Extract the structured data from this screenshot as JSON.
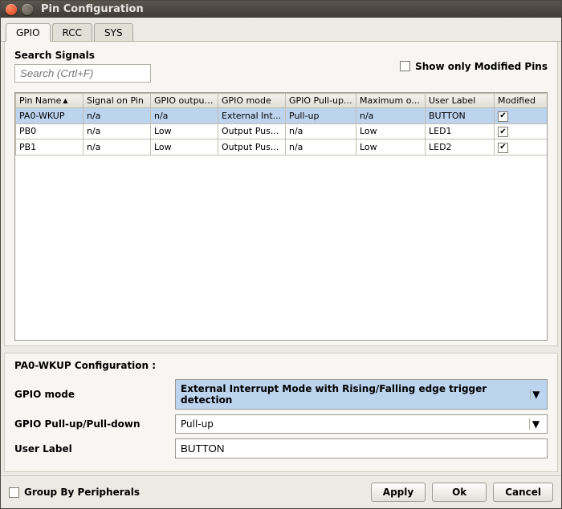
{
  "window_title": "Pin Configuration",
  "tabs": [
    "GPIO",
    "RCC",
    "SYS"
  ],
  "active_tab": 0,
  "search": {
    "label": "Search Signals",
    "placeholder": "Search (Crtl+F)"
  },
  "show_only_modified": {
    "label": "Show only Modified Pins",
    "checked": false
  },
  "columns": [
    "Pin Name",
    "Signal on Pin",
    "GPIO output...",
    "GPIO mode",
    "GPIO Pull-up...",
    "Maximum o...",
    "User Label",
    "Modified"
  ],
  "sort_col": 0,
  "rows": [
    {
      "pin": "PA0-WKUP",
      "signal": "n/a",
      "output": "n/a",
      "mode": "External Int...",
      "pull": "Pull-up",
      "max": "n/a",
      "label": "BUTTON",
      "modified": true,
      "selected": true
    },
    {
      "pin": "PB0",
      "signal": "n/a",
      "output": "Low",
      "mode": "Output Pus...",
      "pull": "n/a",
      "max": "Low",
      "label": "LED1",
      "modified": true,
      "selected": false
    },
    {
      "pin": "PB1",
      "signal": "n/a",
      "output": "Low",
      "mode": "Output Pus...",
      "pull": "n/a",
      "max": "Low",
      "label": "LED2",
      "modified": true,
      "selected": false
    }
  ],
  "config": {
    "title": "PA0-WKUP Configuration :",
    "gpio_mode": {
      "label": "GPIO mode",
      "value": "External Interrupt Mode with Rising/Falling edge trigger detection"
    },
    "pull": {
      "label": "GPIO Pull-up/Pull-down",
      "value": "Pull-up"
    },
    "user_label": {
      "label": "User Label",
      "value": "BUTTON"
    }
  },
  "group_by": {
    "label": "Group By Peripherals",
    "checked": false
  },
  "buttons": {
    "apply": "Apply",
    "ok": "Ok",
    "cancel": "Cancel"
  }
}
